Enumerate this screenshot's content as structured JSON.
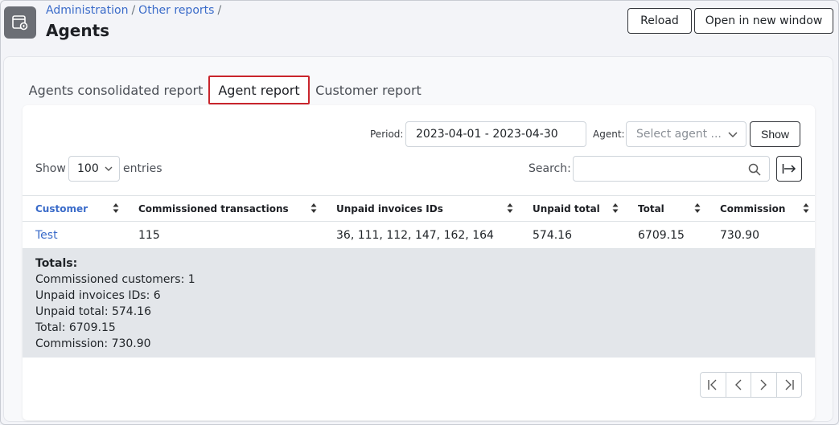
{
  "header": {
    "breadcrumb": [
      "Administration",
      "Other reports"
    ],
    "title": "Agents",
    "reload_label": "Reload",
    "open_new_window_label": "Open in new window",
    "app_icon": "report-icon"
  },
  "tabs": [
    {
      "label": "Agents consolidated report",
      "active": false
    },
    {
      "label": "Agent report",
      "active": true
    },
    {
      "label": "Customer report",
      "active": false
    }
  ],
  "filters": {
    "period_label": "Period:",
    "period_value": "2023-04-01 - 2023-04-30",
    "agent_label": "Agent:",
    "agent_placeholder": "Select agent ...",
    "show_button": "Show"
  },
  "entries": {
    "show_label": "Show",
    "page_size": "100",
    "entries_label": "entries"
  },
  "search": {
    "label": "Search:",
    "value": ""
  },
  "table": {
    "columns": [
      "Customer",
      "Commissioned transactions",
      "Unpaid invoices IDs",
      "Unpaid total",
      "Total",
      "Commission"
    ],
    "rows": [
      [
        "Test",
        "115",
        "36, 111, 112, 147, 162, 164",
        "574.16",
        "6709.15",
        "730.90"
      ]
    ]
  },
  "totals": {
    "heading": "Totals:",
    "lines": [
      "Commissioned customers: 1",
      "Unpaid invoices IDs: 6",
      "Unpaid total: 574.16",
      "Total: 6709.15",
      "Commission: 730.90"
    ]
  },
  "colors": {
    "accent_link": "#3a6bc9",
    "active_tab_border": "#c9252c",
    "totals_bg": "#e3e6ea"
  }
}
